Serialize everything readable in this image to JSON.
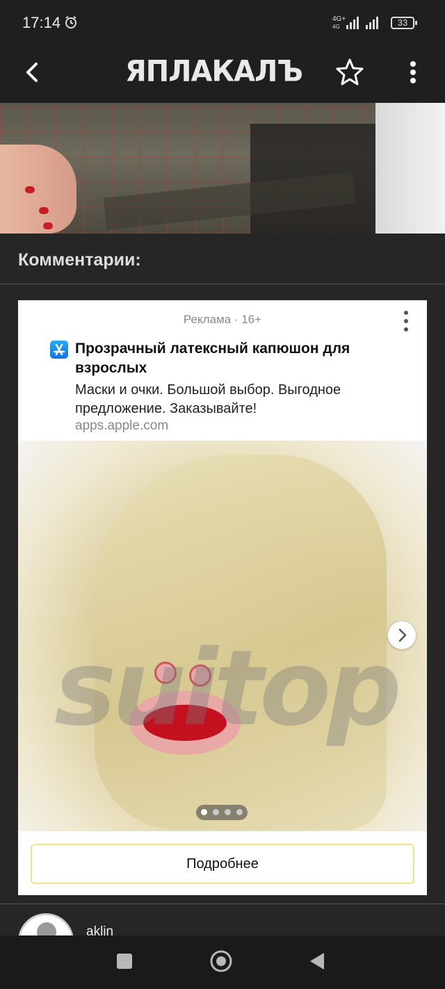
{
  "status_bar": {
    "time": "17:14",
    "network_label": "4G+",
    "network_sub": "4G",
    "battery": "33"
  },
  "toolbar": {
    "logo_text": "ЯПЛАКАЛЪ"
  },
  "comments": {
    "title": "Комментарии:"
  },
  "ad": {
    "label": "Реклама · 16+",
    "title": "Прозрачный латексный капюшон для взрослых",
    "description": "Маски и очки. Большой выбор. Выгодное предложение. Заказывайте!",
    "url": "apps.apple.com",
    "image_watermark": "suitop",
    "carousel": {
      "total": 4,
      "active": 1
    },
    "button_label": "Подробнее"
  },
  "comment": {
    "username": "aklin"
  },
  "colors": {
    "background": "#262626",
    "toolbar": "#1f1f1f",
    "ad_button_border": "#f0e48a",
    "mouth_red": "#c3111f"
  }
}
